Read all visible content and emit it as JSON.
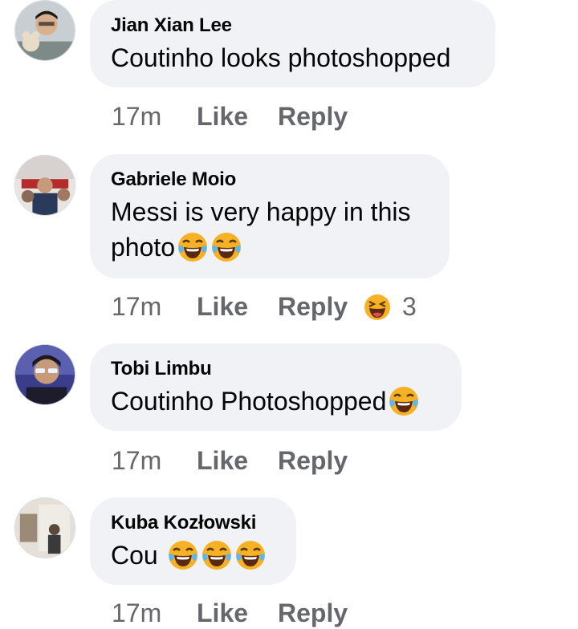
{
  "comments": [
    {
      "author": "Jian Xian Lee",
      "text": "Coutinho looks photoshopped",
      "time": "17m",
      "like": "Like",
      "reply": "Reply",
      "emoji_icons": []
    },
    {
      "author": "Gabriele Moio",
      "text_line1": "Messi is very happy in this",
      "text_line2": "photo",
      "time": "17m",
      "like": "Like",
      "reply": "Reply",
      "emoji_icons": [
        "tears-of-joy-icon",
        "tears-of-joy-icon"
      ],
      "reaction": {
        "icon": "laughing-reaction-icon",
        "count": "3"
      }
    },
    {
      "author": "Tobi Limbu",
      "text": "Coutinho Photoshopped",
      "time": "17m",
      "like": "Like",
      "reply": "Reply",
      "emoji_icons": [
        "tears-of-joy-icon"
      ]
    },
    {
      "author": "Kuba Kozłowski",
      "text": "Cou",
      "time": "17m",
      "like": "Like",
      "reply": "Reply",
      "emoji_icons": [
        "tears-of-joy-icon",
        "tears-of-joy-icon",
        "tears-of-joy-icon"
      ]
    }
  ],
  "colors": {
    "bubble_bg": "#f0f2f5",
    "author_text": "#050505",
    "meta_text": "#65676b",
    "emoji_yellow": "#f7b125"
  }
}
